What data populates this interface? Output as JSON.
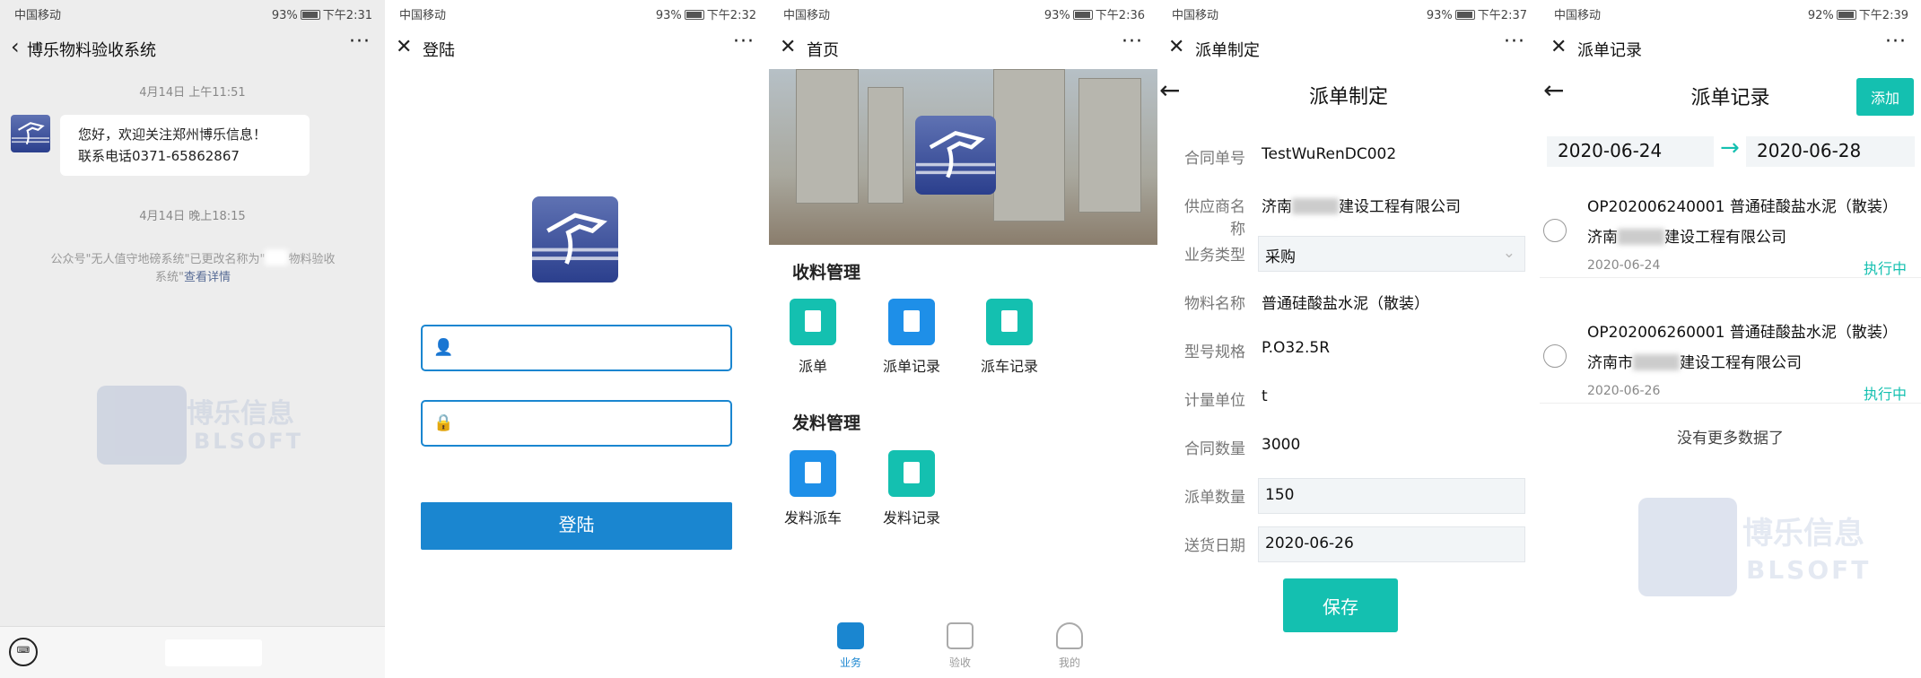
{
  "status": [
    {
      "carrier": "中国移动",
      "battery": "93%",
      "time": "下午2:31"
    },
    {
      "carrier": "中国移动",
      "battery": "93%",
      "time": "下午2:32"
    },
    {
      "carrier": "中国移动",
      "battery": "93%",
      "time": "下午2:36"
    },
    {
      "carrier": "中国移动",
      "battery": "93%",
      "time": "下午2:37"
    },
    {
      "carrier": "中国移动",
      "battery": "92%",
      "time": "下午2:39"
    }
  ],
  "chat": {
    "title": "博乐物料验收系统",
    "time1": "4月14日 上午11:51",
    "msg1": "您好，欢迎关注郑州博乐信息！",
    "msg2": "联系电话0371-65862867",
    "time2": "4月14日 晚上18:15",
    "notice1": "公众号\"无人值守地磅系统\"已更改名称为\"",
    "notice2": "物料验收",
    "notice3": "系统\"",
    "notice_link": "查看详情",
    "watermark_cn": "博乐信息",
    "watermark_en": "BLSOFT"
  },
  "login": {
    "title": "登陆",
    "username_placeholder": "",
    "password_placeholder": "",
    "button": "登陆"
  },
  "home": {
    "title": "首页",
    "section1": "收料管理",
    "tiles1": [
      "派单",
      "派单记录",
      "派车记录"
    ],
    "section2": "发料管理",
    "tiles2": [
      "发料派车",
      "发料记录"
    ],
    "tabs": [
      "业务",
      "验收",
      "我的"
    ]
  },
  "form": {
    "nav_title": "派单制定",
    "page_title": "派单制定",
    "fields": [
      {
        "label": "合同单号",
        "value": "TestWuRenDC002"
      },
      {
        "label": "供应商名称",
        "value_pre": "济南",
        "value_post": "建设工程有限公司"
      },
      {
        "label": "业务类型",
        "value": "采购"
      },
      {
        "label": "物料名称",
        "value": "普通硅酸盐水泥（散装）"
      },
      {
        "label": "型号规格",
        "value": "P.O32.5R"
      },
      {
        "label": "计量单位",
        "value": "t"
      },
      {
        "label": "合同数量",
        "value": "3000"
      },
      {
        "label": "派单数量",
        "value": "150"
      },
      {
        "label": "送货日期",
        "value": "2020-06-26"
      }
    ],
    "save": "保存"
  },
  "records": {
    "nav_title": "派单记录",
    "page_title": "派单记录",
    "add": "添加",
    "date_from": "2020-06-24",
    "date_to": "2020-06-28",
    "items": [
      {
        "line1": "OP202006240001 普通硅酸盐水泥（散装）",
        "line2_pre": "济南",
        "line2_post": "建设工程有限公司",
        "date": "2020-06-24",
        "status": "执行中"
      },
      {
        "line1": "OP202006260001 普通硅酸盐水泥（散装）",
        "line2_pre": "济南市",
        "line2_post": "建设工程有限公司",
        "date": "2020-06-26",
        "status": "执行中"
      }
    ],
    "no_more": "没有更多数据了"
  },
  "icons": {
    "close": "close-icon",
    "more": "more-icon",
    "back": "back-arrow-icon"
  },
  "colors": {
    "primary": "#1a86d0",
    "teal": "#14c0b0",
    "blue": "#1e8fe8"
  }
}
